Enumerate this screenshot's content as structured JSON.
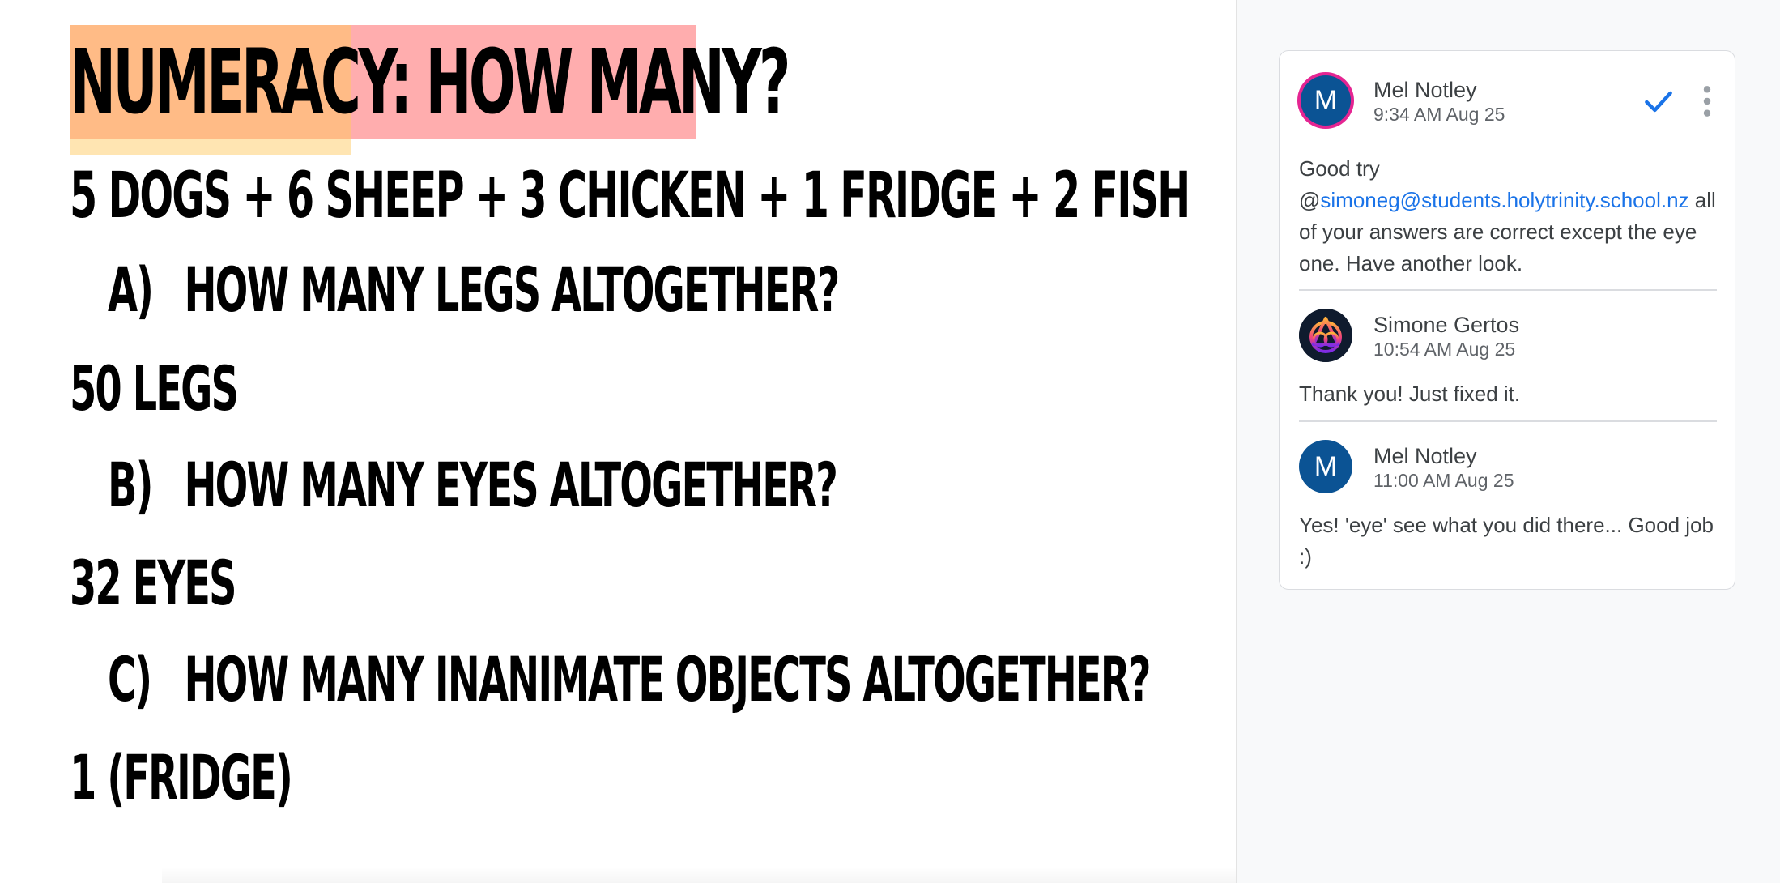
{
  "document": {
    "title": "NUMERACY: HOW MANY?",
    "equation": "5 DOGS + 6 SHEEP + 3 CHICKEN + 1 FRIDGE + 2 FISH",
    "questions": [
      {
        "label": "A)",
        "text": "HOW MANY LEGS ALTOGETHER?",
        "answer": "50 LEGS"
      },
      {
        "label": "B)",
        "text": "HOW MANY EYES ALTOGETHER?",
        "answer": "32 EYES"
      },
      {
        "label": "C)",
        "text": "HOW MANY INANIMATE OBJECTS ALTOGETHER?",
        "answer": "1 (FRIDGE)"
      }
    ],
    "highlight_colors": {
      "title_pink": "#ffadae",
      "title_orange": "#ffbb86",
      "title_yellow": "#ffe5b2"
    }
  },
  "comment_thread": {
    "resolve_icon": "checkmark-icon",
    "more_icon": "more-vert-icon",
    "accent_color": "#1a73e8",
    "comments": [
      {
        "author": "Mel Notley",
        "avatar_initial": "M",
        "time": "9:34 AM Aug 25",
        "text_before": "Good try @",
        "mention": "simoneg@students.holytrinity.school.nz",
        "text_after": " all of your answers are correct except the eye one. Have another look."
      },
      {
        "author": "Simone Gertos",
        "avatar_icon": "trinity-logo-icon",
        "time": "10:54 AM Aug 25",
        "text": "Thank you! Just fixed it."
      },
      {
        "author": "Mel Notley",
        "avatar_initial": "M",
        "time": "11:00 AM Aug 25",
        "text": "Yes! 'eye' see what you did there... Good job :)"
      }
    ]
  }
}
